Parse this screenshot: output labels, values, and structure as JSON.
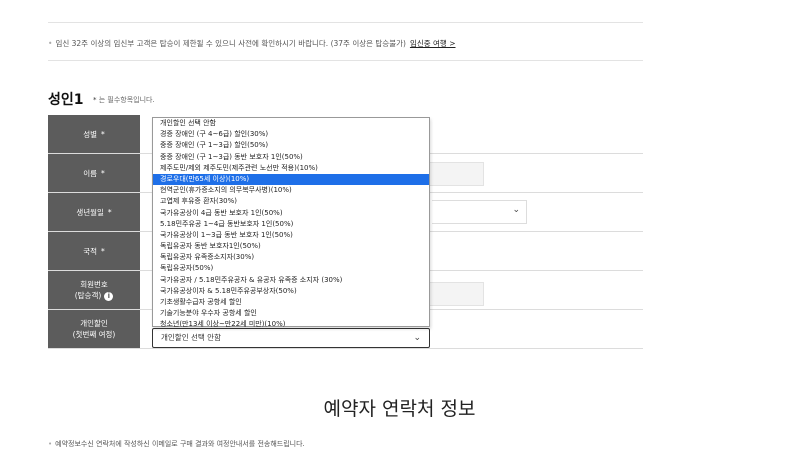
{
  "notice": {
    "text": "임신 32주 이상의 임신부 고객은 탑승이 제한될 수 있으니 사전에 확인하시기 바랍니다. (37주 이상은 탑승불가)",
    "link_label": "임신중 여행 >"
  },
  "section": {
    "title": "성인1",
    "required_star": "*",
    "required_note": "는 필수항목입니다."
  },
  "form": {
    "rows": [
      {
        "label": "성별",
        "required": "*"
      },
      {
        "label": "이름",
        "required": "*"
      },
      {
        "label": "생년월일",
        "required": "*"
      },
      {
        "label": "국적",
        "required": "*"
      },
      {
        "label_line1": "회원번호",
        "label_line2": "(탑승객)"
      },
      {
        "label_line1": "개인할인",
        "label_line2": "(첫번째 여정)"
      }
    ],
    "discount_select": {
      "value": "개인할인 선택 안함",
      "options": [
        "개인할인 선택 안함",
        "경증 장애인 (구 4~6급) 할인(30%)",
        "중증 장애인 (구 1~3급) 할인(50%)",
        "중증 장애인 (구 1~3급) 동반 보호자 1인(50%)",
        "제주도민/제외 제주도민(제주관련 노선만 적용)(10%)",
        "경로우대(만65세 이상)(10%)",
        "현역군인(휴가증소지의 의무복무사병)(10%)",
        "고엽제 후유증 환자(30%)",
        "국가유공상이 4급 동반 보호자 1인(50%)",
        "5.18민주유공 1~4급 동반보호자 1인(50%)",
        "국가유공상이 1~3급 동반 보호자 1인(50%)",
        "독립유공자 동반 보호자1인(50%)",
        "독립유공자 유족증소지자(30%)",
        "독립유공자(50%)",
        "국가유공자 / 5.18민주유공자 & 유공자 유족증 소지자 (30%)",
        "국가유공상이자 & 5.18민주유공부상자(50%)",
        "기초생활수급자 공항세 할인",
        "기술기능분야 우수자 공항세 할인",
        "청소년(만13세 이상~만22세 미만)(10%)"
      ],
      "highlighted_index": 5
    }
  },
  "contact": {
    "title": "예약자 연락처 정보",
    "note": "예약정보수신 연락처에 작성하신 이메일로 구매 결과와 여정안내서를 전송해드립니다."
  },
  "icons": {
    "info": "info-icon",
    "chevron": "chevron-down-icon"
  }
}
